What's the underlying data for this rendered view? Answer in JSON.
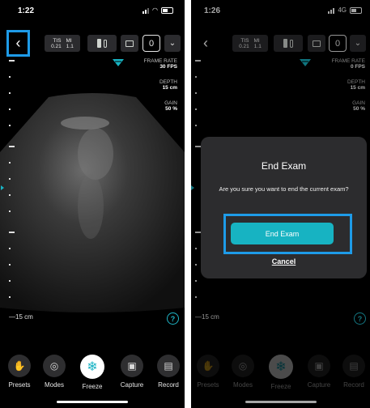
{
  "left_screen": {
    "status_time": "1:22",
    "toolbar": {
      "tis_label": "TIS",
      "mi_label": "MI",
      "tis_value": "0.21",
      "mi_value": "1.1",
      "image_count": "0"
    },
    "readouts": {
      "frame_rate_label": "FRAME RATE",
      "frame_rate_value": "30 FPS",
      "depth_label": "DEPTH",
      "depth_value": "15 cm",
      "gain_label": "GAIN",
      "gain_value": "50 %"
    },
    "depth_scale_label": "15 cm",
    "help": "?",
    "bottom_bar": [
      {
        "label": "Presets",
        "icon": "hand-icon"
      },
      {
        "label": "Modes",
        "icon": "modes-icon"
      },
      {
        "label": "Freeze",
        "icon": "snowflake-icon"
      },
      {
        "label": "Capture",
        "icon": "camera-icon"
      },
      {
        "label": "Record",
        "icon": "record-icon"
      }
    ]
  },
  "right_screen": {
    "status_time": "1:26",
    "network": "4G",
    "toolbar": {
      "tis_label": "TIS",
      "mi_label": "MI",
      "tis_value": "0.21",
      "mi_value": "1.1",
      "image_count": "0"
    },
    "readouts": {
      "frame_rate_label": "FRAME RATE",
      "frame_rate_value": "0 FPS",
      "depth_label": "DEPTH",
      "depth_value": "15 cm",
      "gain_label": "GAIN",
      "gain_value": "50 %"
    },
    "depth_scale_label": "15 cm",
    "help": "?",
    "dialog": {
      "title": "End Exam",
      "message": "Are you sure you want to end the current exam?",
      "primary": "End Exam",
      "cancel": "Cancel"
    },
    "bottom_bar": [
      {
        "label": "Presets",
        "icon": "hand-icon"
      },
      {
        "label": "Modes",
        "icon": "modes-icon"
      },
      {
        "label": "Freeze",
        "icon": "snowflake-icon"
      },
      {
        "label": "Capture",
        "icon": "camera-icon"
      },
      {
        "label": "Record",
        "icon": "record-icon"
      }
    ]
  },
  "colors": {
    "accent": "#17b3c2",
    "highlight": "#1e9be8",
    "panel": "#2c2c2e"
  }
}
